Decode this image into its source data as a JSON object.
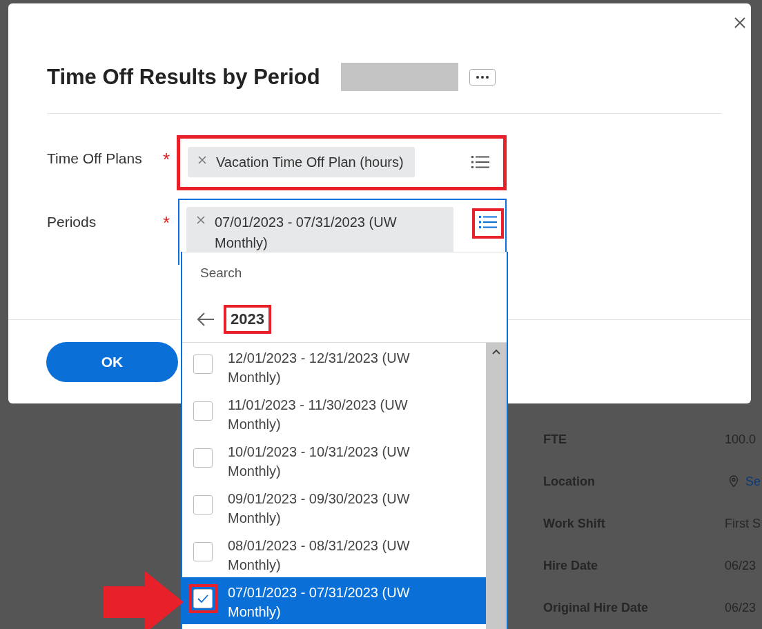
{
  "background_details": [
    {
      "label": "FTE",
      "value": "100.0",
      "kind": "text"
    },
    {
      "label": "Location",
      "value": "Se",
      "kind": "location"
    },
    {
      "label": "Work Shift",
      "value": "First S",
      "kind": "text"
    },
    {
      "label": "Hire Date",
      "value": "06/23",
      "kind": "text"
    },
    {
      "label": "Original Hire Date",
      "value": "06/23",
      "kind": "text"
    }
  ],
  "dialog": {
    "title": "Time Off Results by Period",
    "fields": [
      {
        "label": "Time Off Plans",
        "required_mark": "*",
        "highlighted": true,
        "focused": false,
        "prompt_highlighted": false,
        "chips": [
          "Vacation Time Off Plan (hours)"
        ]
      },
      {
        "label": "Periods",
        "required_mark": "*",
        "highlighted": false,
        "focused": true,
        "prompt_highlighted": true,
        "chips": [
          "07/01/2023 - 07/31/2023 (UW Monthly)"
        ]
      }
    ],
    "dropdown": {
      "search_placeholder": "Search",
      "breadcrumb": "2023",
      "breadcrumb_highlighted": true,
      "options": [
        {
          "label": "12/01/2023 - 12/31/2023 (UW Monthly)",
          "checked": false,
          "selected": false,
          "highlighted": false
        },
        {
          "label": "11/01/2023 - 11/30/2023 (UW Monthly)",
          "checked": false,
          "selected": false,
          "highlighted": false
        },
        {
          "label": "10/01/2023 - 10/31/2023 (UW Monthly)",
          "checked": false,
          "selected": false,
          "highlighted": false
        },
        {
          "label": "09/01/2023 - 09/30/2023 (UW Monthly)",
          "checked": false,
          "selected": false,
          "highlighted": false
        },
        {
          "label": "08/01/2023 - 08/31/2023 (UW Monthly)",
          "checked": false,
          "selected": false,
          "highlighted": false
        },
        {
          "label": "07/01/2023 - 07/31/2023 (UW Monthly)",
          "checked": true,
          "selected": true,
          "highlighted": true
        }
      ]
    },
    "buttons": [
      "OK"
    ]
  }
}
